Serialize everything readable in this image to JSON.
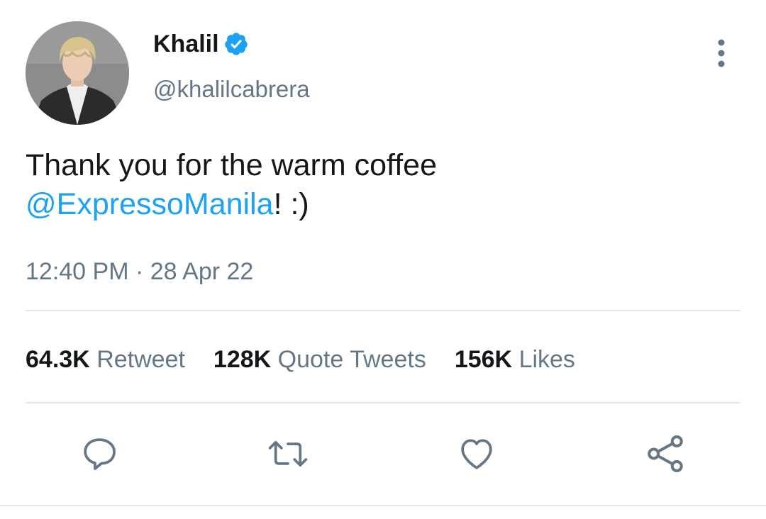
{
  "author": {
    "display_name": "Khalil",
    "handle": "@khalilcabrera",
    "verified": true,
    "verified_icon": "verified-badge-icon",
    "verified_color": "#1da1f2"
  },
  "tweet": {
    "text_line1": "Thank you for the warm coffee",
    "mention": "@ExpressoManila",
    "text_after_mention": "! :)"
  },
  "meta": {
    "time": "12:40 PM",
    "separator": "·",
    "date": "28 Apr 22"
  },
  "stats": [
    {
      "count": "64.3K",
      "label": "Retweet"
    },
    {
      "count": "128K",
      "label": "Quote Tweets"
    },
    {
      "count": "156K",
      "label": "Likes"
    }
  ],
  "actions": [
    {
      "icon": "reply-icon"
    },
    {
      "icon": "retweet-icon"
    },
    {
      "icon": "like-icon"
    },
    {
      "icon": "share-icon"
    }
  ],
  "colors": {
    "accent": "#1da1f2",
    "secondary_text": "#657786",
    "primary_text": "#14171a",
    "divider": "#e1e8ed"
  }
}
